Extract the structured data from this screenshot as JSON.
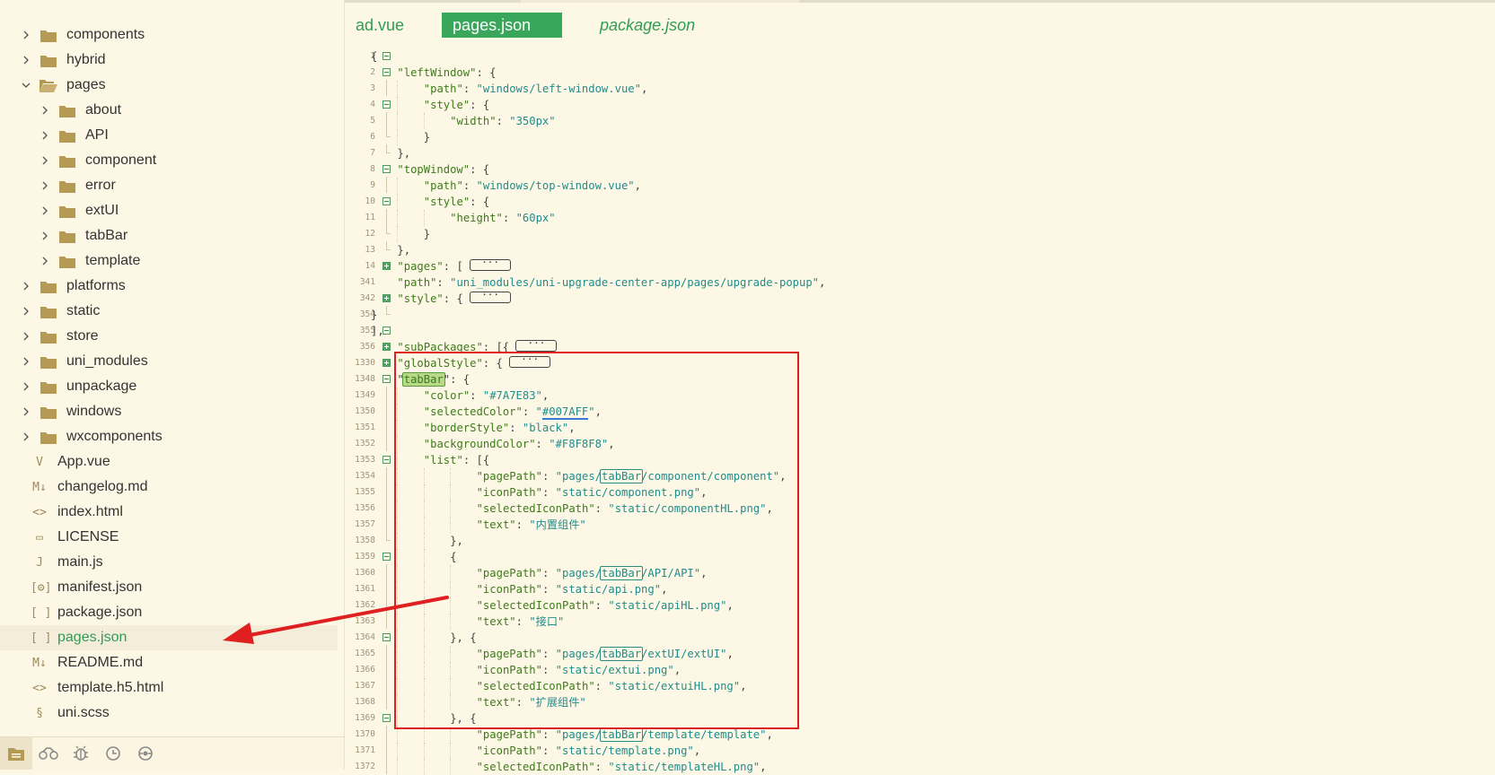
{
  "editor": {
    "tabs": [
      {
        "label": "ad.vue"
      },
      {
        "label": "pages.json"
      },
      {
        "label": "package.json"
      }
    ]
  },
  "sidebar": {
    "items": [
      {
        "label": "components",
        "type": "folder",
        "depth": 0,
        "expanded": false
      },
      {
        "label": "hybrid",
        "type": "folder",
        "depth": 0,
        "expanded": false
      },
      {
        "label": "pages",
        "type": "folder",
        "depth": 0,
        "expanded": true
      },
      {
        "label": "about",
        "type": "folder",
        "depth": 1,
        "expanded": false
      },
      {
        "label": "API",
        "type": "folder",
        "depth": 1,
        "expanded": false
      },
      {
        "label": "component",
        "type": "folder",
        "depth": 1,
        "expanded": false
      },
      {
        "label": "error",
        "type": "folder",
        "depth": 1,
        "expanded": false
      },
      {
        "label": "extUI",
        "type": "folder",
        "depth": 1,
        "expanded": false
      },
      {
        "label": "tabBar",
        "type": "folder",
        "depth": 1,
        "expanded": false
      },
      {
        "label": "template",
        "type": "folder",
        "depth": 1,
        "expanded": false
      },
      {
        "label": "platforms",
        "type": "folder",
        "depth": 0,
        "expanded": false
      },
      {
        "label": "static",
        "type": "folder",
        "depth": 0,
        "expanded": false
      },
      {
        "label": "store",
        "type": "folder",
        "depth": 0,
        "expanded": false
      },
      {
        "label": "uni_modules",
        "type": "folder",
        "depth": 0,
        "expanded": false
      },
      {
        "label": "unpackage",
        "type": "folder",
        "depth": 0,
        "expanded": false
      },
      {
        "label": "windows",
        "type": "folder",
        "depth": 0,
        "expanded": false
      },
      {
        "label": "wxcomponents",
        "type": "folder",
        "depth": 0,
        "expanded": false
      },
      {
        "label": "App.vue",
        "type": "file",
        "glyph": "V"
      },
      {
        "label": "changelog.md",
        "type": "file",
        "glyph": "M↓"
      },
      {
        "label": "index.html",
        "type": "file",
        "glyph": "<>"
      },
      {
        "label": "LICENSE",
        "type": "file",
        "glyph": "▭"
      },
      {
        "label": "main.js",
        "type": "file",
        "glyph": "J"
      },
      {
        "label": "manifest.json",
        "type": "file",
        "glyph": "[⚙]"
      },
      {
        "label": "package.json",
        "type": "file",
        "glyph": "[ ]"
      },
      {
        "label": "pages.json",
        "type": "file",
        "glyph": "[ ]",
        "selected": true
      },
      {
        "label": "README.md",
        "type": "file",
        "glyph": "M↓"
      },
      {
        "label": "template.h5.html",
        "type": "file",
        "glyph": "<>"
      },
      {
        "label": "uni.scss",
        "type": "file",
        "glyph": "§"
      }
    ],
    "bottom_icons": [
      "project-manager-icon",
      "cloud-plugin-icon",
      "debug-icon",
      "source-control-icon",
      "browser-preview-icon"
    ]
  },
  "code": {
    "lines": [
      {
        "n": "1",
        "fold": "m",
        "indent": 0,
        "tokens": [
          [
            "p",
            "{"
          ]
        ]
      },
      {
        "n": "2",
        "fold": "m",
        "indent": 1,
        "tokens": [
          [
            "k",
            "\"leftWindow\""
          ],
          [
            "p",
            ": {"
          ]
        ]
      },
      {
        "n": "3",
        "fold": "v",
        "indent": 2,
        "tokens": [
          [
            "k",
            "\"path\""
          ],
          [
            "p",
            ": "
          ],
          [
            "s",
            "\"windows/left-window.vue\""
          ],
          [
            "p",
            ","
          ]
        ]
      },
      {
        "n": "4",
        "fold": "m",
        "indent": 2,
        "tokens": [
          [
            "k",
            "\"style\""
          ],
          [
            "p",
            ": {"
          ]
        ]
      },
      {
        "n": "5",
        "fold": "v",
        "indent": 3,
        "tokens": [
          [
            "k",
            "\"width\""
          ],
          [
            "p",
            ": "
          ],
          [
            "s",
            "\"350px\""
          ]
        ]
      },
      {
        "n": "6",
        "fold": "e",
        "indent": 2,
        "tokens": [
          [
            "p",
            "}"
          ]
        ]
      },
      {
        "n": "7",
        "fold": "e",
        "indent": 1,
        "tokens": [
          [
            "p",
            "},"
          ]
        ]
      },
      {
        "n": "8",
        "fold": "m",
        "indent": 1,
        "tokens": [
          [
            "k",
            "\"topWindow\""
          ],
          [
            "p",
            ": {"
          ]
        ]
      },
      {
        "n": "9",
        "fold": "v",
        "indent": 2,
        "tokens": [
          [
            "k",
            "\"path\""
          ],
          [
            "p",
            ": "
          ],
          [
            "s",
            "\"windows/top-window.vue\""
          ],
          [
            "p",
            ","
          ]
        ]
      },
      {
        "n": "10",
        "fold": "m",
        "indent": 2,
        "tokens": [
          [
            "k",
            "\"style\""
          ],
          [
            "p",
            ": {"
          ]
        ]
      },
      {
        "n": "11",
        "fold": "v",
        "indent": 3,
        "tokens": [
          [
            "k",
            "\"height\""
          ],
          [
            "p",
            ": "
          ],
          [
            "s",
            "\"60px\""
          ]
        ]
      },
      {
        "n": "12",
        "fold": "e",
        "indent": 2,
        "tokens": [
          [
            "p",
            "}"
          ]
        ]
      },
      {
        "n": "13",
        "fold": "e",
        "indent": 1,
        "tokens": [
          [
            "p",
            "},"
          ]
        ]
      },
      {
        "n": "14",
        "fold": "p",
        "indent": 1,
        "tokens": [
          [
            "k",
            "\"pages\""
          ],
          [
            "p",
            ": [ "
          ],
          [
            "c",
            "···"
          ]
        ]
      },
      {
        "n": "341",
        "fold": "",
        "indent": 1,
        "tokens": [
          [
            "k",
            "\"path\""
          ],
          [
            "p",
            ": "
          ],
          [
            "s",
            "\"uni_modules/uni-upgrade-center-app/pages/upgrade-popup\""
          ],
          [
            "p",
            ","
          ]
        ]
      },
      {
        "n": "342",
        "fold": "p",
        "indent": 1,
        "tokens": [
          [
            "k",
            "\"style\""
          ],
          [
            "p",
            ": { "
          ],
          [
            "c",
            "···"
          ]
        ]
      },
      {
        "n": "354",
        "fold": "e",
        "indent": 0,
        "tokens": [
          [
            "p",
            "}"
          ]
        ]
      },
      {
        "n": "355",
        "fold": "m",
        "indent": 0,
        "tokens": [
          [
            "p",
            "],"
          ]
        ]
      },
      {
        "n": "356",
        "fold": "p",
        "indent": 1,
        "tokens": [
          [
            "k",
            "\"subPackages\""
          ],
          [
            "p",
            ": [{ "
          ],
          [
            "c",
            "···"
          ]
        ]
      },
      {
        "n": "1330",
        "fold": "p",
        "indent": 1,
        "tokens": [
          [
            "k",
            "\"globalStyle\""
          ],
          [
            "p",
            ": { "
          ],
          [
            "c",
            "···"
          ]
        ]
      },
      {
        "n": "1348",
        "fold": "m",
        "indent": 1,
        "tokens": [
          [
            "p",
            "\""
          ],
          [
            "sel",
            "tabBar"
          ],
          [
            "p",
            "\": {"
          ]
        ]
      },
      {
        "n": "1349",
        "fold": "v",
        "indent": 2,
        "tokens": [
          [
            "k",
            "\"color\""
          ],
          [
            "p",
            ": "
          ],
          [
            "s",
            "\"#7A7E83\""
          ],
          [
            "p",
            ","
          ]
        ]
      },
      {
        "n": "1350",
        "fold": "v",
        "indent": 2,
        "tokens": [
          [
            "k",
            "\"selectedColor\""
          ],
          [
            "p",
            ": "
          ],
          [
            "s",
            "\""
          ],
          [
            "ul",
            "#007AFF"
          ],
          [
            "s",
            "\""
          ],
          [
            "p",
            ","
          ]
        ]
      },
      {
        "n": "1351",
        "fold": "v",
        "indent": 2,
        "tokens": [
          [
            "k",
            "\"borderStyle\""
          ],
          [
            "p",
            ": "
          ],
          [
            "s",
            "\"black\""
          ],
          [
            "p",
            ","
          ]
        ]
      },
      {
        "n": "1352",
        "fold": "v",
        "indent": 2,
        "tokens": [
          [
            "k",
            "\"backgroundColor\""
          ],
          [
            "p",
            ": "
          ],
          [
            "s",
            "\"#F8F8F8\""
          ],
          [
            "p",
            ","
          ]
        ]
      },
      {
        "n": "1353",
        "fold": "m",
        "indent": 2,
        "tokens": [
          [
            "k",
            "\"list\""
          ],
          [
            "p",
            ": [{"
          ]
        ]
      },
      {
        "n": "1354",
        "fold": "v",
        "indent": 4,
        "tokens": [
          [
            "k",
            "\"pagePath\""
          ],
          [
            "p",
            ": "
          ],
          [
            "s",
            "\"pages/"
          ],
          [
            "box",
            "tabBar"
          ],
          [
            "s",
            "/component/component\""
          ],
          [
            "p",
            ","
          ]
        ]
      },
      {
        "n": "1355",
        "fold": "v",
        "indent": 4,
        "tokens": [
          [
            "k",
            "\"iconPath\""
          ],
          [
            "p",
            ": "
          ],
          [
            "s",
            "\"static/component.png\""
          ],
          [
            "p",
            ","
          ]
        ]
      },
      {
        "n": "1356",
        "fold": "v",
        "indent": 4,
        "tokens": [
          [
            "k",
            "\"selectedIconPath\""
          ],
          [
            "p",
            ": "
          ],
          [
            "s",
            "\"static/componentHL.png\""
          ],
          [
            "p",
            ","
          ]
        ]
      },
      {
        "n": "1357",
        "fold": "v",
        "indent": 4,
        "tokens": [
          [
            "k",
            "\"text\""
          ],
          [
            "p",
            ": "
          ],
          [
            "s",
            "\"内置组件\""
          ]
        ]
      },
      {
        "n": "1358",
        "fold": "e",
        "indent": 3,
        "tokens": [
          [
            "p",
            "},"
          ]
        ]
      },
      {
        "n": "1359",
        "fold": "m",
        "indent": 3,
        "tokens": [
          [
            "p",
            "{"
          ]
        ]
      },
      {
        "n": "1360",
        "fold": "v",
        "indent": 4,
        "tokens": [
          [
            "k",
            "\"pagePath\""
          ],
          [
            "p",
            ": "
          ],
          [
            "s",
            "\"pages/"
          ],
          [
            "box",
            "tabBar"
          ],
          [
            "s",
            "/API/API\""
          ],
          [
            "p",
            ","
          ]
        ]
      },
      {
        "n": "1361",
        "fold": "v",
        "indent": 4,
        "tokens": [
          [
            "k",
            "\"iconPath\""
          ],
          [
            "p",
            ": "
          ],
          [
            "s",
            "\"static/api.png\""
          ],
          [
            "p",
            ","
          ]
        ]
      },
      {
        "n": "1362",
        "fold": "v",
        "indent": 4,
        "tokens": [
          [
            "k",
            "\"selectedIconPath\""
          ],
          [
            "p",
            ": "
          ],
          [
            "s",
            "\"static/apiHL.png\""
          ],
          [
            "p",
            ","
          ]
        ]
      },
      {
        "n": "1363",
        "fold": "v",
        "indent": 4,
        "tokens": [
          [
            "k",
            "\"text\""
          ],
          [
            "p",
            ": "
          ],
          [
            "s",
            "\"接口\""
          ]
        ]
      },
      {
        "n": "1364",
        "fold": "m",
        "indent": 3,
        "tokens": [
          [
            "p",
            "}, {"
          ]
        ]
      },
      {
        "n": "1365",
        "fold": "v",
        "indent": 4,
        "tokens": [
          [
            "k",
            "\"pagePath\""
          ],
          [
            "p",
            ": "
          ],
          [
            "s",
            "\"pages/"
          ],
          [
            "box",
            "tabBar"
          ],
          [
            "s",
            "/extUI/extUI\""
          ],
          [
            "p",
            ","
          ]
        ]
      },
      {
        "n": "1366",
        "fold": "v",
        "indent": 4,
        "tokens": [
          [
            "k",
            "\"iconPath\""
          ],
          [
            "p",
            ": "
          ],
          [
            "s",
            "\"static/extui.png\""
          ],
          [
            "p",
            ","
          ]
        ]
      },
      {
        "n": "1367",
        "fold": "v",
        "indent": 4,
        "tokens": [
          [
            "k",
            "\"selectedIconPath\""
          ],
          [
            "p",
            ": "
          ],
          [
            "s",
            "\"static/extuiHL.png\""
          ],
          [
            "p",
            ","
          ]
        ]
      },
      {
        "n": "1368",
        "fold": "v",
        "indent": 4,
        "tokens": [
          [
            "k",
            "\"text\""
          ],
          [
            "p",
            ": "
          ],
          [
            "s",
            "\"扩展组件\""
          ]
        ]
      },
      {
        "n": "1369",
        "fold": "m",
        "indent": 3,
        "tokens": [
          [
            "p",
            "}, {"
          ]
        ]
      },
      {
        "n": "1370",
        "fold": "v",
        "indent": 4,
        "tokens": [
          [
            "k",
            "\"pagePath\""
          ],
          [
            "p",
            ": "
          ],
          [
            "s",
            "\"pages/"
          ],
          [
            "box",
            "tabBar"
          ],
          [
            "s",
            "/template/template\""
          ],
          [
            "p",
            ","
          ]
        ]
      },
      {
        "n": "1371",
        "fold": "v",
        "indent": 4,
        "tokens": [
          [
            "k",
            "\"iconPath\""
          ],
          [
            "p",
            ": "
          ],
          [
            "s",
            "\"static/template.png\""
          ],
          [
            "p",
            ","
          ]
        ]
      },
      {
        "n": "1372",
        "fold": "v",
        "indent": 4,
        "tokens": [
          [
            "k",
            "\"selectedIconPath\""
          ],
          [
            "p",
            ": "
          ],
          [
            "s",
            "\"static/templateHL.png\""
          ],
          [
            "p",
            ","
          ]
        ]
      }
    ]
  },
  "colors": {
    "accent": "#3aa65c",
    "annotation": "#e02020",
    "background": "#fdf8e6"
  }
}
